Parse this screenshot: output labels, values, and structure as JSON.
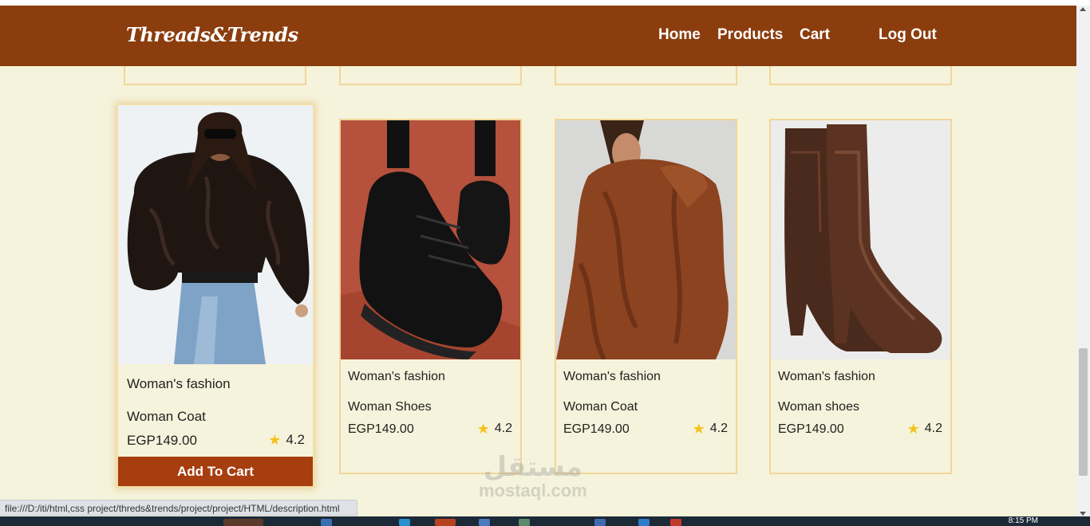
{
  "header": {
    "brand": "Threads&Trends",
    "nav": [
      "Home",
      "Products",
      "Cart",
      "Log Out"
    ]
  },
  "products": [
    {
      "category": "Woman's fashion",
      "name": "Woman Coat",
      "price": "EGP149.00",
      "rating": "4.2",
      "image": "black-fur-coat",
      "button": "Add To Cart"
    },
    {
      "category": "Woman's fashion",
      "name": "Woman Shoes",
      "price": "EGP149.00",
      "rating": "4.2",
      "image": "black-sneakers"
    },
    {
      "category": "Woman's fashion",
      "name": "Woman Coat",
      "price": "EGP149.00",
      "rating": "4.2",
      "image": "brown-teddy-coat"
    },
    {
      "category": "Woman's fashion",
      "name": "Woman shoes",
      "price": "EGP149.00",
      "rating": "4.2",
      "image": "brown-leather-boots"
    }
  ],
  "status_bar": {
    "url": "file:///D:/iti/html,css project/threds&trends/project/project/HTML/description.html"
  },
  "watermark": {
    "arabic": "مستقل",
    "latin": "mostaql.com"
  },
  "taskbar": {
    "time": "8:15 PM"
  },
  "colors": {
    "navbar": "#8b3d0e",
    "background": "#f5f3db",
    "card_border": "#f1d69a",
    "button": "#a83d10",
    "star": "#f5c21b"
  }
}
